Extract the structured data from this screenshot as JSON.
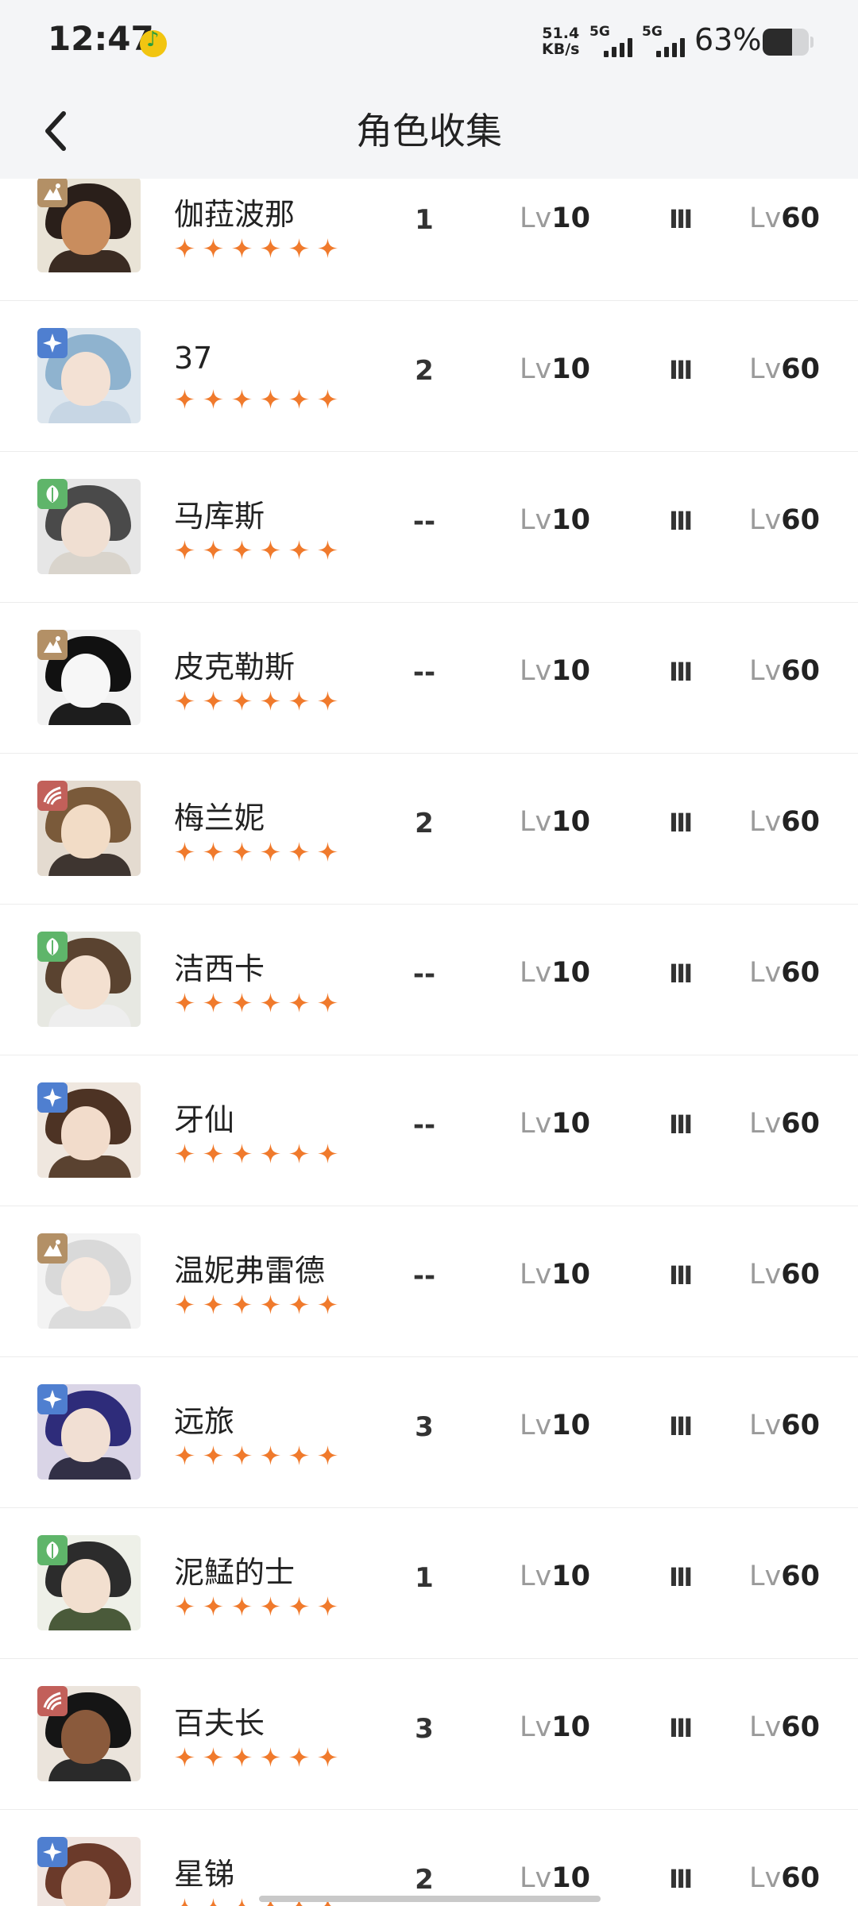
{
  "status_bar": {
    "time": "12:47",
    "net_speed_value": "51.4",
    "net_speed_unit": "KB/s",
    "sim1_label": "5G",
    "sim2_label": "5G",
    "battery_percent": "63%",
    "battery_level": 0.63
  },
  "header": {
    "title": "角色收集",
    "back_icon": "chevron-left-icon"
  },
  "colors": {
    "star": "#f07a2c",
    "element_earth": "#b39066",
    "element_star": "#4f7fd0",
    "element_plant": "#5fb56a",
    "element_beast": "#c2605a"
  },
  "characters": [
    {
      "name": "伽菈波那",
      "element": "earth",
      "stars": 6,
      "rank": "1",
      "lv_prefix": "Lv",
      "skill_level": "10",
      "tier": "Ⅲ",
      "level": "60"
    },
    {
      "name": "37",
      "element": "star",
      "stars": 6,
      "rank": "2",
      "lv_prefix": "Lv",
      "skill_level": "10",
      "tier": "Ⅲ",
      "level": "60"
    },
    {
      "name": "马库斯",
      "element": "plant",
      "stars": 6,
      "rank": "--",
      "lv_prefix": "Lv",
      "skill_level": "10",
      "tier": "Ⅲ",
      "level": "60"
    },
    {
      "name": "皮克勒斯",
      "element": "earth",
      "stars": 6,
      "rank": "--",
      "lv_prefix": "Lv",
      "skill_level": "10",
      "tier": "Ⅲ",
      "level": "60"
    },
    {
      "name": "梅兰妮",
      "element": "beast",
      "stars": 6,
      "rank": "2",
      "lv_prefix": "Lv",
      "skill_level": "10",
      "tier": "Ⅲ",
      "level": "60"
    },
    {
      "name": "洁西卡",
      "element": "plant",
      "stars": 6,
      "rank": "--",
      "lv_prefix": "Lv",
      "skill_level": "10",
      "tier": "Ⅲ",
      "level": "60"
    },
    {
      "name": "牙仙",
      "element": "star",
      "stars": 6,
      "rank": "--",
      "lv_prefix": "Lv",
      "skill_level": "10",
      "tier": "Ⅲ",
      "level": "60"
    },
    {
      "name": "温妮弗雷德",
      "element": "earth",
      "stars": 6,
      "rank": "--",
      "lv_prefix": "Lv",
      "skill_level": "10",
      "tier": "Ⅲ",
      "level": "60"
    },
    {
      "name": "远旅",
      "element": "star",
      "stars": 6,
      "rank": "3",
      "lv_prefix": "Lv",
      "skill_level": "10",
      "tier": "Ⅲ",
      "level": "60"
    },
    {
      "name": "泥鯭的士",
      "element": "plant",
      "stars": 6,
      "rank": "1",
      "lv_prefix": "Lv",
      "skill_level": "10",
      "tier": "Ⅲ",
      "level": "60"
    },
    {
      "name": "百夫长",
      "element": "beast",
      "stars": 6,
      "rank": "3",
      "lv_prefix": "Lv",
      "skill_level": "10",
      "tier": "Ⅲ",
      "level": "60"
    },
    {
      "name": "星锑",
      "element": "star",
      "stars": 6,
      "rank": "2",
      "lv_prefix": "Lv",
      "skill_level": "10",
      "tier": "Ⅲ",
      "level": "60"
    }
  ]
}
